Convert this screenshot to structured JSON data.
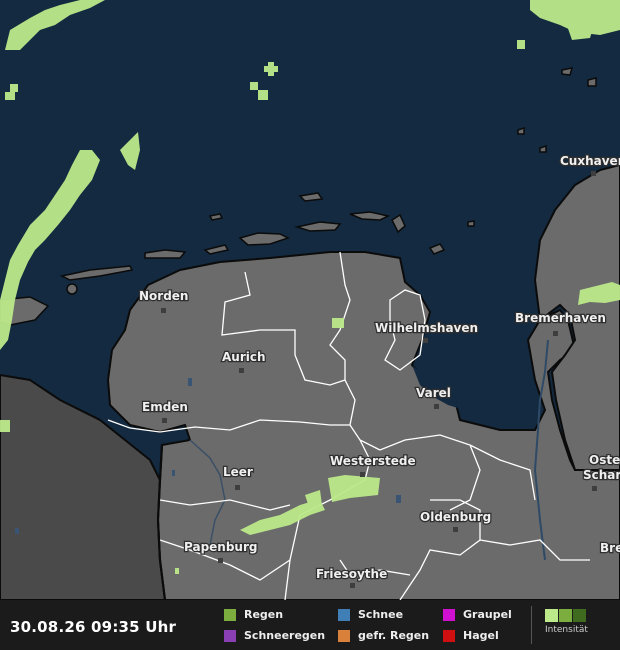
{
  "map": {
    "colors": {
      "sea": "#132a40",
      "land": "#6b6b6b",
      "foreign_land": "#4a4a4a",
      "rain_light": "#bce98a",
      "border": "#ffffff",
      "coast": "#0b0b0b"
    },
    "cities": [
      {
        "name": "Cuxhaven"
      },
      {
        "name": "Norden"
      },
      {
        "name": "Wilhelmshaven"
      },
      {
        "name": "Bremerhaven"
      },
      {
        "name": "Aurich"
      },
      {
        "name": "Emden"
      },
      {
        "name": "Varel"
      },
      {
        "name": "Leer"
      },
      {
        "name": "Westerstede"
      },
      {
        "name": "Oste"
      },
      {
        "name": "Schar"
      },
      {
        "name": "Oldenburg"
      },
      {
        "name": "Papenburg"
      },
      {
        "name": "Bre"
      },
      {
        "name": "Friesoythe"
      }
    ]
  },
  "legend": {
    "timestamp": "30.08.26 09:35 Uhr",
    "items": [
      {
        "label": "Regen",
        "color": "#7cad3f"
      },
      {
        "label": "Schneeregen",
        "color": "#8a3fb5"
      },
      {
        "label": "Schnee",
        "color": "#3f7fb5"
      },
      {
        "label": "gefr. Regen",
        "color": "#d9803a"
      },
      {
        "label": "Graupel",
        "color": "#d010d0"
      },
      {
        "label": "Hagel",
        "color": "#d01010"
      }
    ],
    "intensity_label": "Intensität",
    "intensity_colors": [
      "#bce98a",
      "#7cad3f",
      "#3f6b1f"
    ]
  }
}
